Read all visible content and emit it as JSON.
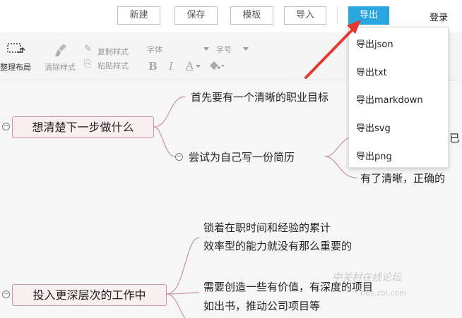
{
  "toolbar": {
    "new_label": "新建",
    "save_label": "保存",
    "template_label": "模板",
    "import_label": "导入",
    "export_label": "导出",
    "login_label": "登录"
  },
  "format_toolbar": {
    "arrange_layout": "整理布局",
    "clear_style": "清除样式",
    "copy_style": "复制样式",
    "paste_style": "粘贴样式",
    "font_label": "字体",
    "font_size_label": "字号",
    "bold": "B",
    "italic": "I",
    "font_color": "A"
  },
  "export_menu": {
    "items": [
      "导出json",
      "导出txt",
      "导出markdown",
      "导出svg",
      "导出png"
    ]
  },
  "mindmap": {
    "node1": {
      "label": "想清楚下一步做什么",
      "child1": "首先要有一个清晰的职业目标",
      "child2": "尝试为自己写一份简历",
      "child2_sub_partial": "已",
      "child2_sub2": "有了清晰，正确的"
    },
    "node2": {
      "label": "投入更深层次的工作中",
      "child1_line1": "锁着在职时间和经验的累计",
      "child1_line2": "效率型的能力就没有那么重要的",
      "child2_line1": "需要创造一些有价值，有深度的项目",
      "child2_line2": "如出书，推动公司项目等"
    }
  },
  "watermark": {
    "text": "中关村在线论坛",
    "url": "bbs.zol.com"
  },
  "colors": {
    "accent": "#2aa6de",
    "node_border": "#c795a4",
    "node_fill": "#f9eef0",
    "connector": "#c795a4",
    "arrow": "#e23a2e"
  }
}
